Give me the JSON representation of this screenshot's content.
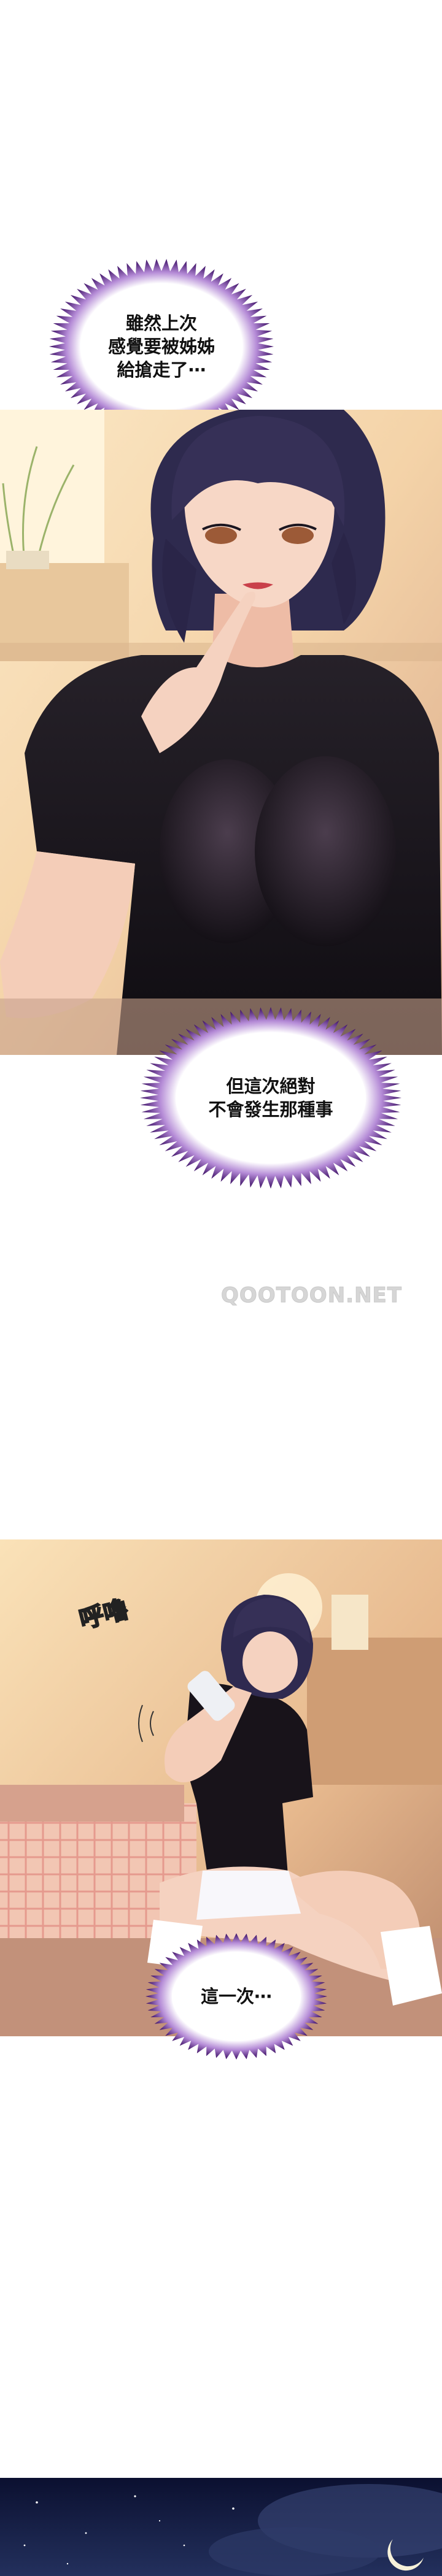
{
  "bubbles": {
    "b1": "雖然上次\n感覺要被姊姊\n給搶走了⋯",
    "b2": "但這次絕對\n不會發生那種事",
    "b3": "這一次⋯"
  },
  "sfx": "呼嚕",
  "watermark": "QOOTOON.NET",
  "colors": {
    "aura": "#5a1a8a",
    "hair": "#2e2a4e",
    "shirt": "#151217",
    "skin": "#f5d2c0",
    "night": "#0e1433"
  }
}
